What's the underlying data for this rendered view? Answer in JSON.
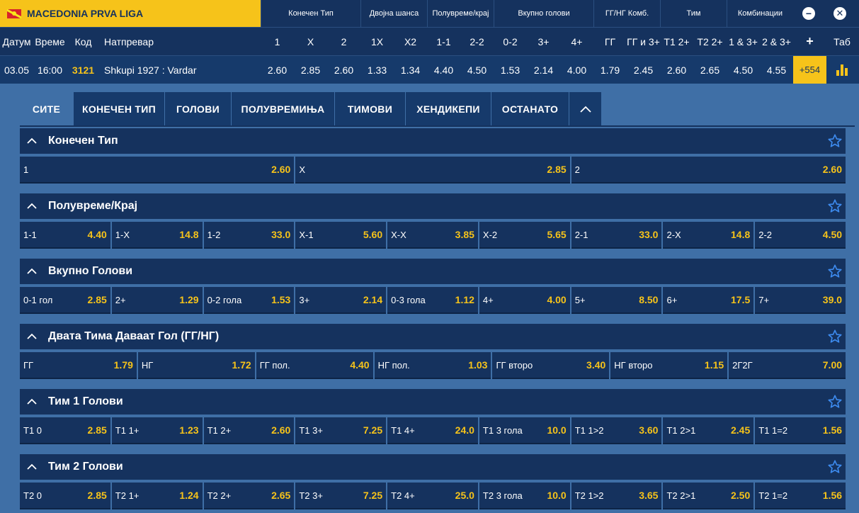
{
  "league": {
    "name": "MACEDONIA PRVA LIGA"
  },
  "header_groups": [
    {
      "label": "Конечен Тип",
      "width": 141
    },
    {
      "label": "Двојна шанса",
      "width": 94
    },
    {
      "label": "Полувреме/крај",
      "width": 94
    },
    {
      "label": "Вкупно голови",
      "width": 141
    },
    {
      "label": "ГГ/НГ Комб.",
      "width": 94
    },
    {
      "label": "Тим",
      "width": 94
    },
    {
      "label": "Комбинации",
      "width": 94
    }
  ],
  "columns": {
    "date": "Датум",
    "time": "Време",
    "code": "Код",
    "match": "Натпревар",
    "odds": [
      "1",
      "X",
      "2",
      "1X",
      "X2",
      "1-1",
      "2-2",
      "0-2",
      "3+",
      "4+",
      "ГГ",
      "ГГ и 3+",
      "Т1 2+",
      "Т2 2+",
      "1 & 3+",
      "2 & 3+"
    ],
    "plus": "+",
    "tab": "Таб"
  },
  "event": {
    "date": "03.05",
    "time": "16:00",
    "code": "3121",
    "match": "Shkupi 1927 : Vardar",
    "odds": [
      "2.60",
      "2.85",
      "2.60",
      "1.33",
      "1.34",
      "4.40",
      "4.50",
      "1.53",
      "2.14",
      "4.00",
      "1.79",
      "2.45",
      "2.60",
      "2.65",
      "4.50",
      "4.55"
    ],
    "more": "+554"
  },
  "tabs": [
    {
      "label": "СИТЕ",
      "active": true
    },
    {
      "label": "КОНЕЧЕН ТИП"
    },
    {
      "label": "ГОЛОВИ"
    },
    {
      "label": "ПОЛУВРЕМИЊА"
    },
    {
      "label": "ТИМОВИ"
    },
    {
      "label": "ХЕНДИКЕПИ"
    },
    {
      "label": "ОСТАНАТО"
    }
  ],
  "markets": [
    {
      "title": "Конечен Тип",
      "items": [
        [
          "1",
          "2.60"
        ],
        [
          "X",
          "2.85"
        ],
        [
          "2",
          "2.60"
        ]
      ]
    },
    {
      "title": "Полувреме/Крај",
      "items": [
        [
          "1-1",
          "4.40"
        ],
        [
          "1-X",
          "14.8"
        ],
        [
          "1-2",
          "33.0"
        ],
        [
          "X-1",
          "5.60"
        ],
        [
          "X-X",
          "3.85"
        ],
        [
          "X-2",
          "5.65"
        ],
        [
          "2-1",
          "33.0"
        ],
        [
          "2-X",
          "14.8"
        ],
        [
          "2-2",
          "4.50"
        ]
      ]
    },
    {
      "title": "Вкупно Голови",
      "items": [
        [
          "0-1 гол",
          "2.85"
        ],
        [
          "2+",
          "1.29"
        ],
        [
          "0-2 гола",
          "1.53"
        ],
        [
          "3+",
          "2.14"
        ],
        [
          "0-3 гола",
          "1.12"
        ],
        [
          "4+",
          "4.00"
        ],
        [
          "5+",
          "8.50"
        ],
        [
          "6+",
          "17.5"
        ],
        [
          "7+",
          "39.0"
        ]
      ]
    },
    {
      "title": "Двата Тима Даваат Гол (ГГ/НГ)",
      "items": [
        [
          "ГГ",
          "1.79"
        ],
        [
          "НГ",
          "1.72"
        ],
        [
          "ГГ пол.",
          "4.40"
        ],
        [
          "НГ пол.",
          "1.03"
        ],
        [
          "ГГ второ",
          "3.40"
        ],
        [
          "НГ второ",
          "1.15"
        ],
        [
          "2Г2Г",
          "7.00"
        ]
      ]
    },
    {
      "title": "Тим 1 Голови",
      "items": [
        [
          "Т1 0",
          "2.85"
        ],
        [
          "Т1 1+",
          "1.23"
        ],
        [
          "Т1 2+",
          "2.60"
        ],
        [
          "Т1 3+",
          "7.25"
        ],
        [
          "Т1 4+",
          "24.0"
        ],
        [
          "Т1 3 гола",
          "10.0"
        ],
        [
          "Т1 1>2",
          "3.60"
        ],
        [
          "Т1 2>1",
          "2.45"
        ],
        [
          "Т1 1=2",
          "1.56"
        ]
      ]
    },
    {
      "title": "Тим 2 Голови",
      "items": [
        [
          "Т2 0",
          "2.85"
        ],
        [
          "Т2 1+",
          "1.24"
        ],
        [
          "Т2 2+",
          "2.65"
        ],
        [
          "Т2 3+",
          "7.25"
        ],
        [
          "Т2 4+",
          "25.0"
        ],
        [
          "Т2 3 гола",
          "10.0"
        ],
        [
          "Т2 1>2",
          "3.65"
        ],
        [
          "Т2 2>1",
          "2.50"
        ],
        [
          "Т2 1=2",
          "1.56"
        ]
      ]
    }
  ],
  "colors": {
    "accent": "#f6c31a",
    "dark": "#15325e",
    "bg": "#3f6fa6"
  }
}
